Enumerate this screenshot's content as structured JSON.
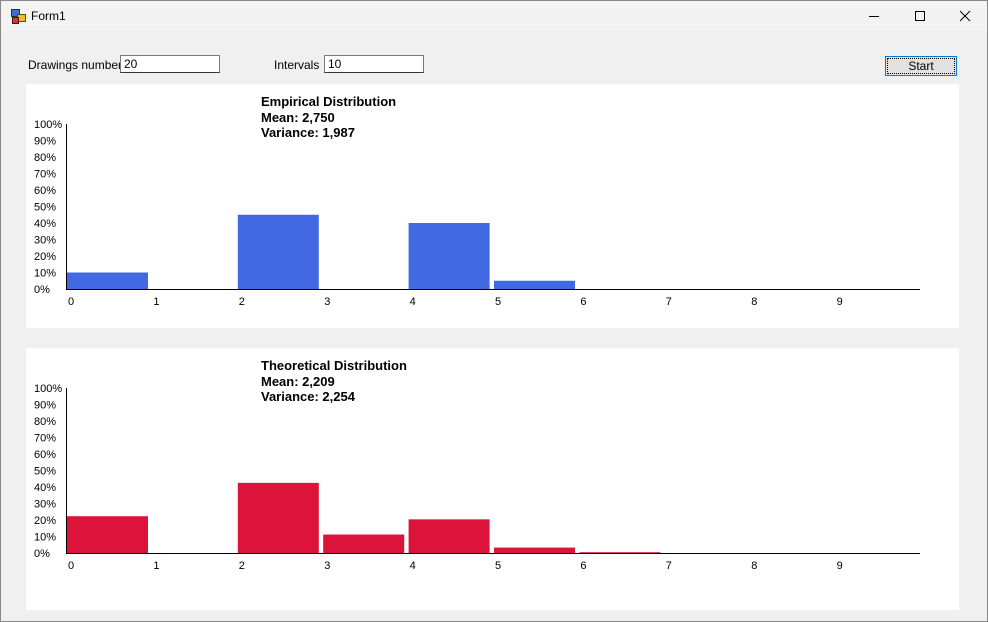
{
  "window": {
    "title": "Form1",
    "minimize_glyph": "—",
    "maximize_glyph": "☐",
    "close_glyph": "✕"
  },
  "controls": {
    "drawings_label": "Drawings number",
    "drawings_value": "20",
    "intervals_label": "Intervals",
    "intervals_value": "10",
    "start_label": "Start"
  },
  "charts": [
    {
      "title": "Empirical Distribution",
      "mean": "Mean: 2,750",
      "variance": "Variance: 1,987"
    },
    {
      "title": "Theoretical Distribution",
      "mean": "Mean: 2,209",
      "variance": "Variance: 2,254"
    }
  ],
  "chart_data": [
    {
      "type": "bar",
      "title": "Empirical Distribution",
      "color": "#4169e1",
      "x_ticks": [
        "0",
        "1",
        "2",
        "3",
        "4",
        "5",
        "6",
        "7",
        "8",
        "9"
      ],
      "y_ticks": [
        "0%",
        "10%",
        "20%",
        "30%",
        "40%",
        "50%",
        "60%",
        "70%",
        "80%",
        "90%",
        "100%"
      ],
      "ylim": [
        0,
        100
      ],
      "bars": [
        {
          "x": 0,
          "value": 10
        },
        {
          "x": 1,
          "value": 0
        },
        {
          "x": 2,
          "value": 45
        },
        {
          "x": 3,
          "value": 0
        },
        {
          "x": 4,
          "value": 40
        },
        {
          "x": 5,
          "value": 5
        },
        {
          "x": 6,
          "value": 0
        },
        {
          "x": 7,
          "value": 0
        },
        {
          "x": 8,
          "value": 0
        },
        {
          "x": 9,
          "value": 0
        }
      ]
    },
    {
      "type": "bar",
      "title": "Theoretical Distribution",
      "color": "#dc143c",
      "x_ticks": [
        "0",
        "1",
        "2",
        "3",
        "4",
        "5",
        "6",
        "7",
        "8",
        "9"
      ],
      "y_ticks": [
        "0%",
        "10%",
        "20%",
        "30%",
        "40%",
        "50%",
        "60%",
        "70%",
        "80%",
        "90%",
        "100%"
      ],
      "ylim": [
        0,
        100
      ],
      "bars": [
        {
          "x": 0,
          "value": 22.3
        },
        {
          "x": 1,
          "value": 0
        },
        {
          "x": 2,
          "value": 42.5
        },
        {
          "x": 3,
          "value": 11.2
        },
        {
          "x": 4,
          "value": 20.4
        },
        {
          "x": 5,
          "value": 3.3
        },
        {
          "x": 6,
          "value": 0.5
        },
        {
          "x": 7,
          "value": 0
        },
        {
          "x": 8,
          "value": 0
        },
        {
          "x": 9,
          "value": 0
        }
      ]
    }
  ]
}
